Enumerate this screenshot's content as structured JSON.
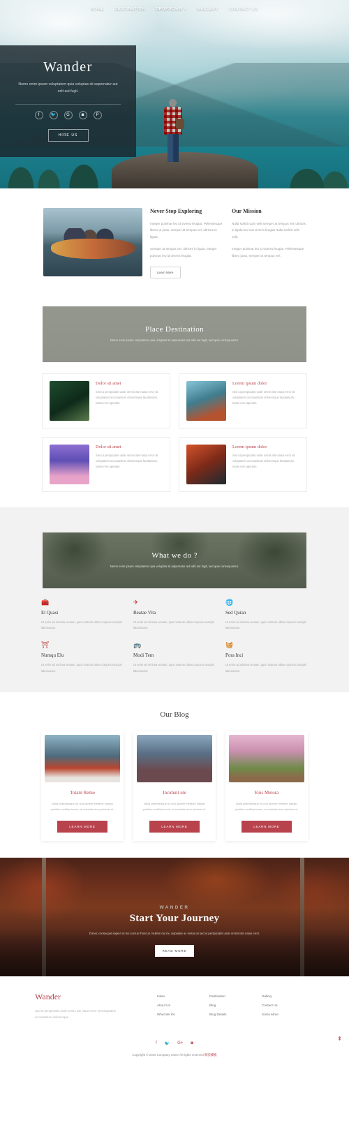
{
  "nav": {
    "items": [
      {
        "label": "HOME"
      },
      {
        "label": "DESTINATION"
      },
      {
        "label": "DROPDOWN ˅"
      },
      {
        "label": "GALLERY"
      },
      {
        "label": "CONTACT US"
      }
    ]
  },
  "hero": {
    "title": "Wander",
    "tagline": "Nemo enim ipsam voluptatem quia voluptas sit aspernatur aut odit aut fugit.",
    "social": [
      {
        "name": "facebook-icon",
        "glyph": "f"
      },
      {
        "name": "twitter-icon",
        "glyph": "🐦"
      },
      {
        "name": "google-plus-icon",
        "glyph": "G"
      },
      {
        "name": "instagram-icon",
        "glyph": "◙"
      },
      {
        "name": "pinterest-icon",
        "glyph": "P"
      }
    ],
    "cta_label": "HIRE US"
  },
  "about": {
    "columns": [
      {
        "title": "Never Stop Exploring",
        "paragraphs": [
          "Integer pulvinar leo id viverra feugiat. Pellentesque libero ut justo, semper at tempus vel, ultrices in ligula.",
          "Semper at tempus vel, ultrices in ligula. Integer pulvinar leo id viverra feugiat."
        ],
        "button": "Learn More"
      },
      {
        "title": "Our Mission",
        "paragraphs": [
          "Nulla sollicit udin velit semper at tempus vel, ultrices in ligula leo sed viverra feugiat Nulla sollicit udin velit.",
          "Integer pulvinar leo id viverra feugiat. Pellentesque libero justo, semper at tempus vel."
        ]
      }
    ]
  },
  "destination": {
    "banner_title": "Place Destination",
    "banner_subtitle": "Nemo enim ipsam voluptatem quia voluptas sit aspernatur aut odit aut fugit, sed quia consequuntur.",
    "cards": [
      {
        "title": "Dolor sit amet",
        "text": "Sed ut perspiciatis unde omnis iste natus error sit voluptatem accusantium doloremque laudantium, totam rem aperiam."
      },
      {
        "title": "Lorem ipsum dolor",
        "text": "Sed ut perspiciatis unde omnis iste natus error sit voluptatem accusantium doloremque laudantium, totam rem aperiam."
      },
      {
        "title": "Dolor sit amet",
        "text": "Sed ut perspiciatis unde omnis iste natus error sit voluptatem accusantium doloremque laudantium, totam rem aperiam."
      },
      {
        "title": "Lorem ipsum dolor",
        "text": "Sed ut perspiciatis unde omnis iste natus error sit voluptatem accusantium doloremque laudantium, totam rem aperiam."
      }
    ]
  },
  "services": {
    "banner_title": "What we do ?",
    "banner_subtitle": "Nemo enim ipsam voluptatem quia voluptas sit aspernatur aut odit aut fugit, sed quia consequuntur.",
    "items": [
      {
        "icon": "suitcase-icon",
        "glyph": "🧰",
        "title": "Et Quasi",
        "text": "Ut enim ad minima veniam, quis nostrum ullam corporis suscipit laboriosam."
      },
      {
        "icon": "airplane-icon",
        "glyph": "✈",
        "title": "Beatae Vita",
        "text": "Ut enim ad minima veniam, quis nostrum ullam corporis suscipit laboriosam."
      },
      {
        "icon": "globe-icon",
        "glyph": "🌐",
        "title": "Sed Quian",
        "text": "Ut enim ad minima veniam, quis nostrum ullam corporis suscipit laboriosam."
      },
      {
        "icon": "hydrant-icon",
        "glyph": "⛩",
        "title": "Numqu Elu",
        "text": "Ut enim ad minima veniam, quis nostrum ullam corporis suscipit laboriosam."
      },
      {
        "icon": "bus-icon",
        "glyph": "🚌",
        "title": "Modi Tem",
        "text": "Ut enim ad minima veniam, quis nostrum ullam corporis suscipit laboriosam."
      },
      {
        "icon": "basket-icon",
        "glyph": "🧺",
        "title": "Pora Inci",
        "text": "Ut enim ad minima veniam, quis nostrum ullam corporis suscipit laboriosam."
      }
    ]
  },
  "blog": {
    "heading": "Our Blog",
    "posts": [
      {
        "title": "Totam Reme",
        "text": "Nulla pellentesque mi non laoreet eleifend Integer porttitor mollitan lorem, at molestie arcu pulvinar ut.",
        "button": "LEARN MORE"
      },
      {
        "title": "Incidunt ute",
        "text": "Nulla pellentesque mi non laoreet eleifend Integer porttitor mollitan lorem, at molestie arcu pulvinar ut.",
        "button": "LEARN MORE"
      },
      {
        "title": "Eius Meiora",
        "text": "Nulla pellentesque mi non laoreet eleifend Integer porttitor mollitan lorem, at molestie arcu pulvinar ut.",
        "button": "LEARN MORE"
      }
    ]
  },
  "cta": {
    "kicker": "WANDER",
    "title": "Start Your Journey",
    "text": "Donec consequat sapien ut leo cursus rhoncus. Nullam dui mi, vulputate ac metus at sed ut perspiciatis unde omnis iste natus error.",
    "button": "READ MORE"
  },
  "footer": {
    "brand": "Wander",
    "brand_text": "Sed ut perspiciatis unde omnis iste natus error sit voluptatem accusantium doloremque.",
    "columns": [
      {
        "links": [
          {
            "label": "Index"
          },
          {
            "label": "About Us"
          },
          {
            "label": "What We Do"
          }
        ]
      },
      {
        "links": [
          {
            "label": "Destination"
          },
          {
            "label": "Blog"
          },
          {
            "label": "Blog Details"
          }
        ]
      },
      {
        "links": [
          {
            "label": "Gallery"
          },
          {
            "label": "Contact Us"
          },
          {
            "label": "Some More"
          }
        ]
      }
    ],
    "social": [
      {
        "name": "facebook-icon",
        "glyph": "f"
      },
      {
        "name": "twitter-icon",
        "glyph": "🐦"
      },
      {
        "name": "google-plus-icon",
        "glyph": "G+"
      },
      {
        "name": "instagram-icon",
        "glyph": "◙"
      }
    ],
    "copyright": "Copyright © 2019 Company name All rights reserved",
    "copyright_link": "网页模板",
    "back_to_top": "⇞"
  },
  "colors": {
    "accent": "#b8434d",
    "icon_red": "#c0392f",
    "banner_gray": "#93978d"
  }
}
